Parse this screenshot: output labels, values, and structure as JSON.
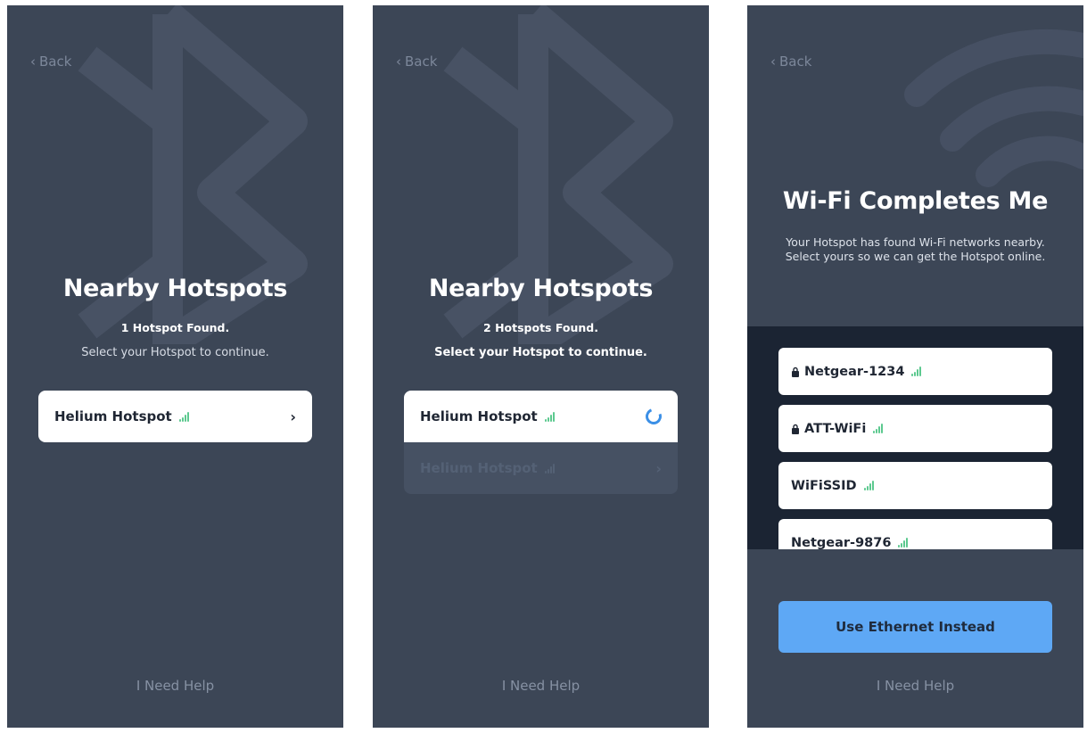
{
  "colors": {
    "screen_bg": "#3c4656",
    "panel_bg": "#1b2433",
    "signal_green": "#5cc98f",
    "primary_blue": "#5ea8f5",
    "spinner_blue": "#3b8fe6"
  },
  "screens": [
    {
      "back_label": "Back",
      "title": "Nearby Hotspots",
      "count_text": "1 Hotspot Found.",
      "instruction": "Select your Hotspot to continue.",
      "hotspots": [
        {
          "name": "Helium Hotspot",
          "state": "chevron"
        }
      ],
      "help_label": "I Need Help",
      "background_icon": "bluetooth-icon"
    },
    {
      "back_label": "Back",
      "title": "Nearby Hotspots",
      "count_text": "2 Hotspots Found.",
      "instruction": "Select your Hotspot to continue.",
      "hotspots": [
        {
          "name": "Helium Hotspot",
          "state": "loading"
        },
        {
          "name": "Helium Hotspot",
          "state": "disabled"
        }
      ],
      "help_label": "I Need Help",
      "background_icon": "bluetooth-icon"
    },
    {
      "back_label": "Back",
      "title": "Wi-Fi Completes Me",
      "description": "Your Hotspot has found Wi-Fi networks nearby. Select yours so we can get the Hotspot online.",
      "networks": [
        {
          "ssid": "Netgear-1234",
          "locked": true
        },
        {
          "ssid": "ATT-WiFi",
          "locked": true
        },
        {
          "ssid": "WiFiSSID",
          "locked": false
        },
        {
          "ssid": "Netgear-9876",
          "locked": false
        }
      ],
      "ethernet_button": "Use Ethernet Instead",
      "help_label": "I Need Help",
      "background_icon": "wifi-icon"
    }
  ]
}
